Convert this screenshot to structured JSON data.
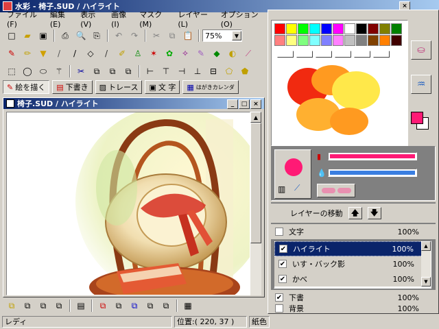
{
  "app": {
    "title": "水彩 - 椅子.SUD / ハイライト",
    "icon": "brush-icon"
  },
  "menu": [
    "ファイル(F)",
    "編集(E)",
    "表示(V)",
    "画像(I)",
    "マスク(M)",
    "レイヤー(L)",
    "オプション(O)"
  ],
  "toolbar": {
    "zoom": "75%"
  },
  "mode_buttons": [
    "絵を描く",
    "下書き",
    "トレース",
    "文 字",
    "はがきカレンダ"
  ],
  "canvas_window": {
    "title": "椅子.SUD / ハイライト"
  },
  "palette_colors": [
    "#ff0000",
    "#ffff00",
    "#00ff00",
    "#00ffff",
    "#0000ff",
    "#ff00ff",
    "#ffffff",
    "#000000",
    "#800000",
    "#808000",
    "#008000",
    "#ff8080",
    "#ffff80",
    "#80ff80",
    "#80ffff",
    "#8080ff",
    "#ff80ff",
    "#c0c0c0",
    "#808080",
    "#804000",
    "#ff8000",
    "#400000"
  ],
  "color": {
    "current": "#ff1a75",
    "hue_slider_color": "#ff1a75",
    "water_slider_color": "#3a7ee0"
  },
  "layers": {
    "move_label": "レイヤーの移動",
    "items": [
      {
        "name": "文字",
        "opacity": "100%",
        "checked": false,
        "selected": false
      },
      {
        "name": "ハイライト",
        "opacity": "100%",
        "checked": true,
        "selected": true
      },
      {
        "name": "いす・バック影",
        "opacity": "100%",
        "checked": true,
        "selected": false
      },
      {
        "name": "かべ",
        "opacity": "100%",
        "checked": true,
        "selected": false
      },
      {
        "name": "下書",
        "opacity": "100%",
        "checked": true,
        "selected": false
      },
      {
        "name": "背景",
        "opacity": "100%",
        "checked": false,
        "selected": false
      }
    ]
  },
  "status": {
    "ready": "レディ",
    "position": "位置:( 220, 37 )",
    "paper": "紙色"
  }
}
